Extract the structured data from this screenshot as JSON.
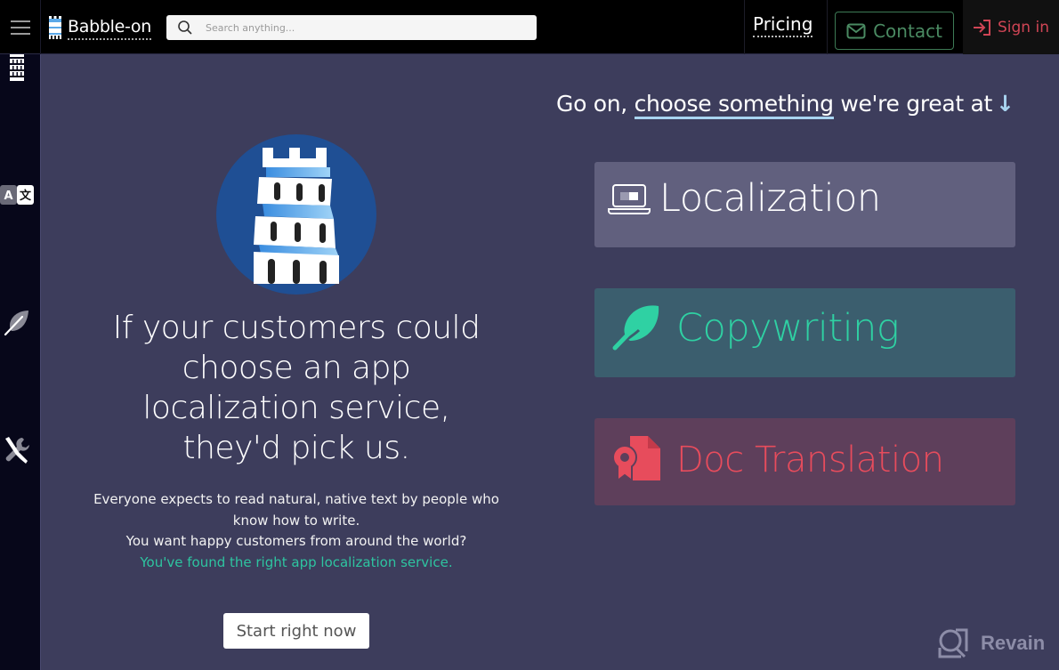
{
  "header": {
    "brand_name": "Babble-on",
    "search_placeholder": "Search anything...",
    "search_value": "",
    "nav": {
      "pricing_label": "Pricing",
      "contact_label": "Contact",
      "signin_label": "Sign in"
    }
  },
  "sidebar": {
    "items": [
      {
        "icon": "tower-icon"
      },
      {
        "icon": "translate-icon"
      },
      {
        "icon": "feather-icon"
      },
      {
        "icon": "tools-icon"
      }
    ]
  },
  "hero": {
    "headline": "If your customers could choose an app localization service, they'd pick us.",
    "paragraph_line1": "Everyone expects to read natural, native text by people who know how to write.",
    "paragraph_line2": "You want happy customers from around the world?",
    "paragraph_accent": "You've found the right app localization service.",
    "cta_label": "Start right now"
  },
  "services": {
    "prompt_prefix": "Go on, ",
    "prompt_link": "choose something",
    "prompt_suffix": " we're great at",
    "prompt_arrow": "↓",
    "items": [
      {
        "label": "Localization",
        "icon": "laptop-translate-icon",
        "color": "#ffffff",
        "bg": "#61607e"
      },
      {
        "label": "Copywriting",
        "icon": "feather-icon",
        "color": "#2fd1a3",
        "bg": "#3b5e6e"
      },
      {
        "label": "Doc Translation",
        "icon": "certificate-doc-icon",
        "color": "#e74c5c",
        "bg": "#5e3f5b"
      }
    ]
  },
  "watermark": {
    "label": "Revain"
  },
  "colors": {
    "background": "#3d3d5c",
    "topbar": "#000000",
    "accent_green": "#2ec4a0",
    "signin_red": "#d04555",
    "contact_green": "#4a8a62"
  }
}
